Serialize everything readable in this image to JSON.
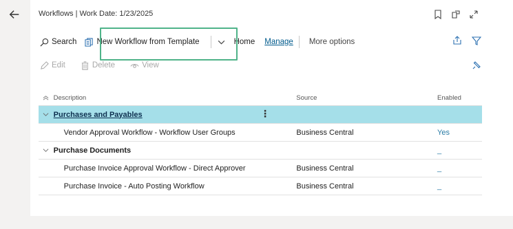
{
  "page": {
    "title": "Workflows | Work Date: 1/23/2025"
  },
  "actions": {
    "search": "Search",
    "new_from_template": "New Workflow from Template",
    "home": "Home",
    "manage": "Manage",
    "more_options": "More options",
    "edit": "Edit",
    "delete": "Delete",
    "view": "View"
  },
  "table": {
    "headers": {
      "description": "Description",
      "source": "Source",
      "enabled": "Enabled"
    },
    "rows": [
      {
        "description": "Purchases and Payables",
        "source": "",
        "enabled": ""
      },
      {
        "description": "Vendor Approval Workflow - Workflow User Groups",
        "source": "Business Central",
        "enabled": "Yes"
      },
      {
        "description": "Purchase Documents",
        "source": "",
        "enabled": "_"
      },
      {
        "description": "Purchase Invoice Approval Workflow - Direct Approver",
        "source": "Business Central",
        "enabled": "_"
      },
      {
        "description": "Purchase Invoice - Auto Posting Workflow",
        "source": "Business Central",
        "enabled": "_"
      }
    ]
  },
  "colors": {
    "selected_row": "#a5dfe9",
    "highlight": "#4fb389",
    "accent": "#005a8c"
  }
}
